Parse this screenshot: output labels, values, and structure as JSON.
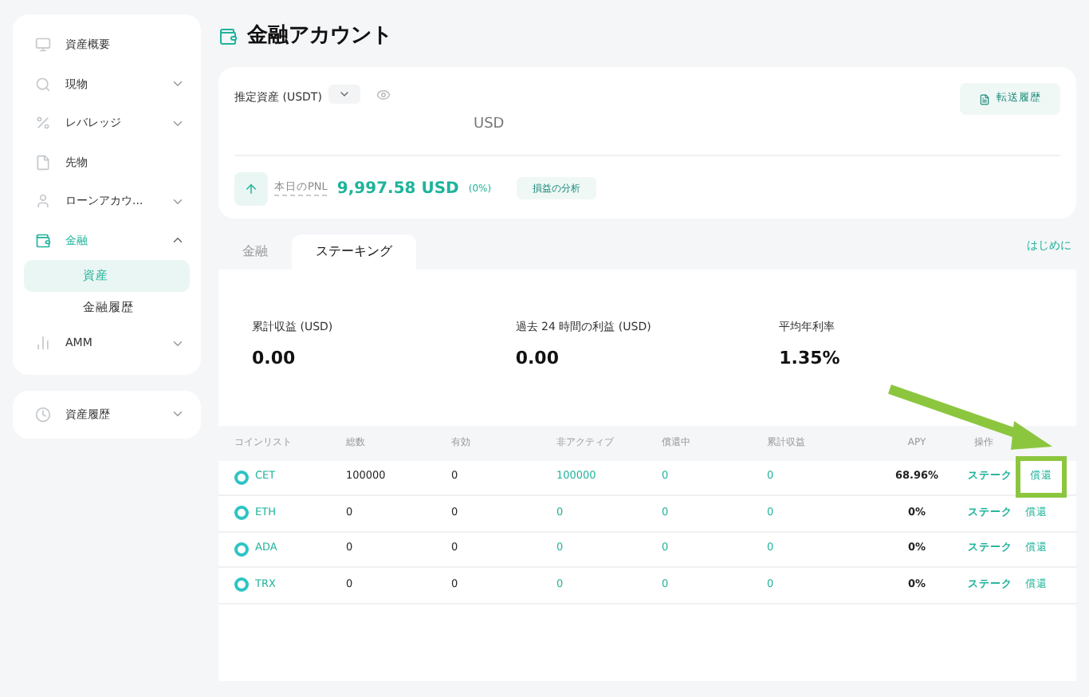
{
  "sidebar": {
    "items": [
      {
        "label": "資産概要",
        "selected": false,
        "expandable": false
      },
      {
        "label": "現物",
        "selected": false,
        "expandable": true,
        "expanded": false
      },
      {
        "label": "レバレッジ",
        "selected": false,
        "expandable": true,
        "expanded": false
      },
      {
        "label": "先物",
        "selected": false,
        "expandable": false
      },
      {
        "label": "ローンアカウ...",
        "selected": false,
        "expandable": true,
        "expanded": false
      },
      {
        "label": "金融",
        "selected": true,
        "expandable": true,
        "expanded": true,
        "children": [
          {
            "label": "資産",
            "selected": true
          },
          {
            "label": "金融履歴",
            "selected": false
          }
        ]
      },
      {
        "label": "AMM",
        "selected": false,
        "expandable": true,
        "expanded": false
      }
    ],
    "extra_items": [
      {
        "label": "資産履歴",
        "selected": false,
        "expandable": true,
        "expanded": false
      }
    ]
  },
  "page_title": "金融アカウント",
  "summary": {
    "estimate_label": "推定資産 (USDT)",
    "currency": "USD",
    "transfer_button": "転送履歴",
    "pnl_label": "本日のPNL",
    "pnl_value": "9,997.58 USD",
    "pnl_percent": "(0%)",
    "analysis_button": "損益の分析"
  },
  "tabs": [
    {
      "label": "金融",
      "selected": false
    },
    {
      "label": "ステーキング",
      "selected": true
    }
  ],
  "guide_link": "はじめに",
  "stats": [
    {
      "label": "累計収益 (USD)",
      "value": "0.00"
    },
    {
      "label": "過去 24 時間の利益 (USD)",
      "value": "0.00"
    },
    {
      "label": "平均年利率",
      "value": "1.35%"
    }
  ],
  "table": {
    "columns": [
      {
        "label": "コインリスト",
        "kind": "accent"
      },
      {
        "label": "総数",
        "kind": "plain"
      },
      {
        "label": "有効",
        "kind": "plain"
      },
      {
        "label": "非アクティブ",
        "kind": "accent"
      },
      {
        "label": "償還中",
        "kind": "accent"
      },
      {
        "label": "累計収益",
        "kind": "accent"
      },
      {
        "label": "APY",
        "kind": "plain"
      },
      {
        "label": "操作",
        "kind": "accent"
      }
    ],
    "rows": [
      {
        "cells": [
          "CET",
          "100000",
          "0",
          "100000",
          "0",
          "0",
          "68.96%"
        ],
        "actions": [
          "ステーク",
          "償還"
        ],
        "highlighted": true
      },
      {
        "cells": [
          "ETH",
          "0",
          "0",
          "0",
          "0",
          "0",
          "0%"
        ],
        "actions": [
          "ステーク",
          "償還"
        ],
        "highlighted": false
      },
      {
        "cells": [
          "ADA",
          "0",
          "0",
          "0",
          "0",
          "0",
          "0%"
        ],
        "actions": [
          "ステーク",
          "償還"
        ],
        "highlighted": false
      },
      {
        "cells": [
          "TRX",
          "0",
          "0",
          "0",
          "0",
          "0",
          "0%"
        ],
        "actions": [
          "ステーク",
          "償還"
        ],
        "highlighted": false
      }
    ]
  }
}
